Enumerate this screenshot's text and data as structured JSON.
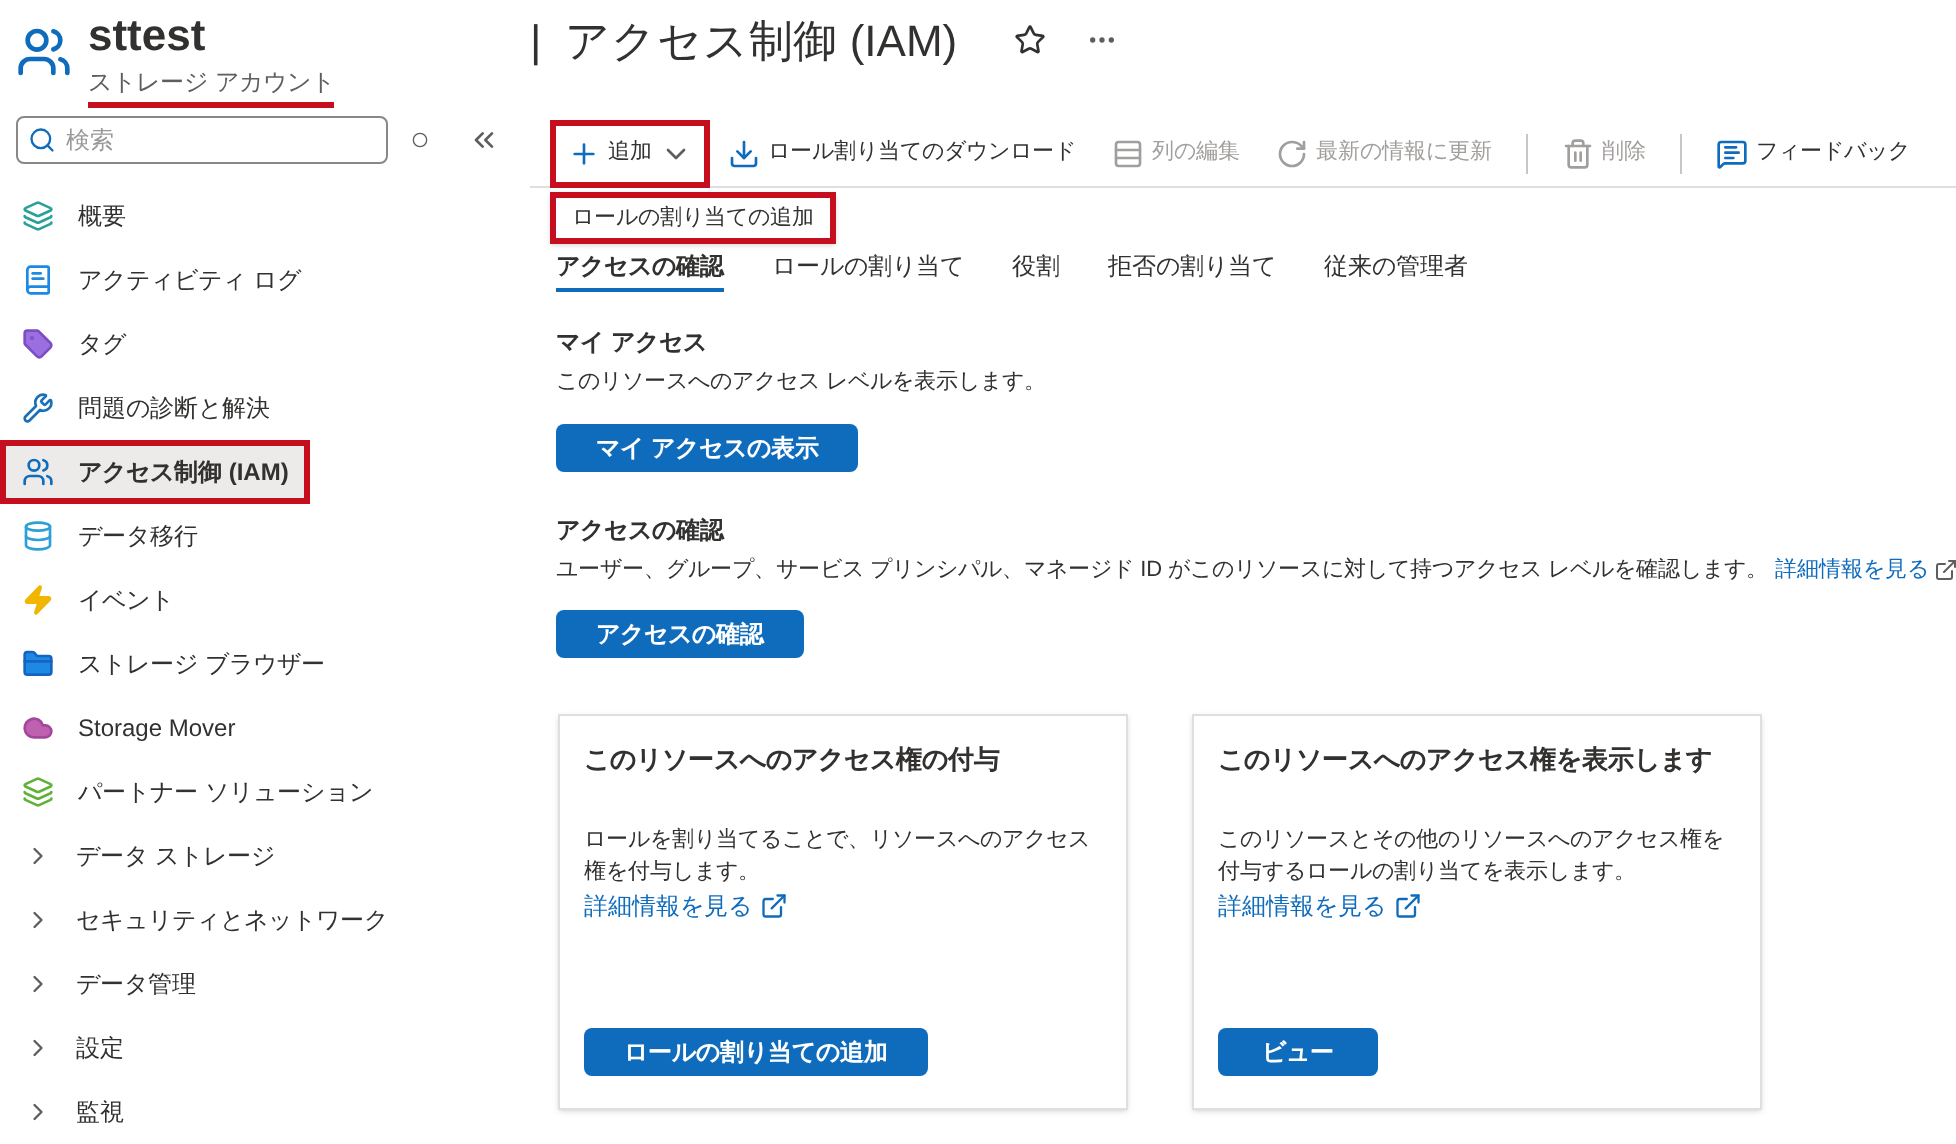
{
  "resource": {
    "name": "sttest",
    "type": "ストレージ アカウント",
    "type_highlighted": true
  },
  "page": {
    "separator": "|",
    "title": "アクセス制御 (IAM)"
  },
  "search": {
    "placeholder": "検索"
  },
  "sidebar": {
    "items": [
      {
        "kind": "link",
        "label": "概要",
        "selected": false,
        "highlighted": false
      },
      {
        "kind": "link",
        "label": "アクティビティ ログ",
        "selected": false,
        "highlighted": false
      },
      {
        "kind": "link",
        "label": "タグ",
        "selected": false,
        "highlighted": false
      },
      {
        "kind": "link",
        "label": "問題の診断と解決",
        "selected": false,
        "highlighted": false
      },
      {
        "kind": "link",
        "label": "アクセス制御 (IAM)",
        "selected": true,
        "highlighted": true
      },
      {
        "kind": "link",
        "label": "データ移行",
        "selected": false,
        "highlighted": false
      },
      {
        "kind": "link",
        "label": "イベント",
        "selected": false,
        "highlighted": false
      },
      {
        "kind": "link",
        "label": "ストレージ ブラウザー",
        "selected": false,
        "highlighted": false
      },
      {
        "kind": "link",
        "label": "Storage Mover",
        "selected": false,
        "highlighted": false
      },
      {
        "kind": "link",
        "label": "パートナー ソリューション",
        "selected": false,
        "highlighted": false
      },
      {
        "kind": "group",
        "label": "データ ストレージ",
        "expanded": false
      },
      {
        "kind": "group",
        "label": "セキュリティとネットワーク",
        "expanded": false
      },
      {
        "kind": "group",
        "label": "データ管理",
        "expanded": false
      },
      {
        "kind": "group",
        "label": "設定",
        "expanded": false
      },
      {
        "kind": "group",
        "label": "監視",
        "expanded": false
      }
    ]
  },
  "toolbar": [
    {
      "kind": "add",
      "label": "追加",
      "disabled": false,
      "highlighted": true
    },
    {
      "kind": "download",
      "label": "ロール割り当てのダウンロード",
      "disabled": false,
      "highlighted": false
    },
    {
      "kind": "columns",
      "label": "列の編集",
      "disabled": true,
      "highlighted": false
    },
    {
      "kind": "refresh",
      "label": "最新の情報に更新",
      "disabled": true,
      "highlighted": false
    },
    {
      "kind": "delete",
      "label": "削除",
      "disabled": true,
      "highlighted": false
    },
    {
      "kind": "feedback",
      "label": "フィードバック",
      "disabled": false,
      "highlighted": false
    }
  ],
  "add_menu": {
    "items": [
      {
        "label": "ロールの割り当ての追加",
        "highlighted": true
      }
    ]
  },
  "tabs": [
    {
      "label": "アクセスの確認",
      "selected": true
    },
    {
      "label": "ロールの割り当て",
      "selected": false
    },
    {
      "label": "役割",
      "selected": false
    },
    {
      "label": "拒否の割り当て",
      "selected": false
    },
    {
      "label": "従来の管理者",
      "selected": false
    }
  ],
  "sections": [
    {
      "heading": "マイ アクセス",
      "text": "このリソースへのアクセス レベルを表示します。",
      "button": "マイ アクセスの表示"
    },
    {
      "heading": "アクセスの確認",
      "text": "ユーザー、グループ、サービス プリンシパル、マネージド ID がこのリソースに対して持つアクセス レベルを確認します。",
      "link": "詳細情報を見る",
      "button": "アクセスの確認"
    }
  ],
  "cards": [
    {
      "title": "このリソースへのアクセス権の付与",
      "text": "ロールを割り当てることで、リソースへのアクセス権を付与します。",
      "link": "詳細情報を見る",
      "button": "ロールの割り当ての追加"
    },
    {
      "title": "このリソースへのアクセス権を表示します",
      "text": "このリソースとその他のリソースへのアクセス権を付与するロールの割り当てを表示します。",
      "link": "詳細情報を見る",
      "button": "ビュー"
    }
  ]
}
